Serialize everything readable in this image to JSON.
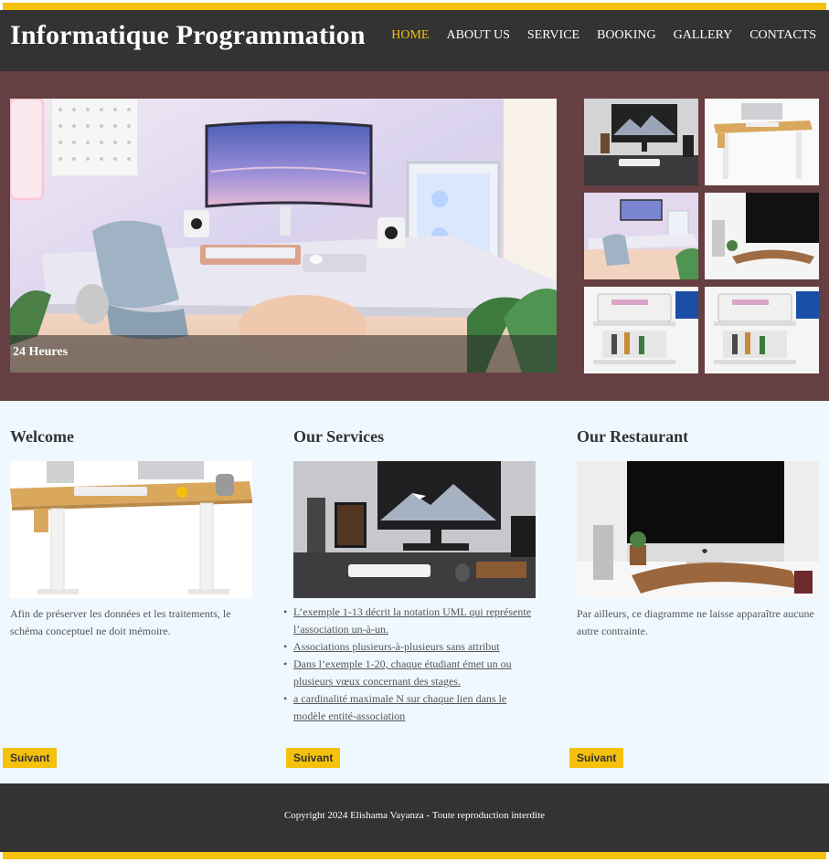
{
  "header": {
    "title": "Informatique Programmation",
    "nav": [
      {
        "label": "HOME",
        "active": true
      },
      {
        "label": "ABOUT US"
      },
      {
        "label": "SERVICE"
      },
      {
        "label": "BOOKING"
      },
      {
        "label": "GALLERY"
      },
      {
        "label": "CONTACTS"
      }
    ]
  },
  "hero": {
    "caption": "24 Heures"
  },
  "sections": {
    "welcome": {
      "title": "Welcome",
      "text": "Afin de préserver les données et les traitements, le schéma conceptuel ne doit mémoire.",
      "button": "Suivant"
    },
    "services": {
      "title": "Our Services",
      "items": [
        "L’exemple 1-13 décrit la notation UML qui représente l’association un-à-un.",
        "Associations plusieurs-à-plusieurs sans attribut",
        "Dans l’exemple 1-20, chaque étudiant émet un ou plusieurs vœux concernant des stages.",
        "a cardinalité maximale N sur chaque lien dans le modèle entité-association"
      ],
      "button": "Suivant"
    },
    "restaurant": {
      "title": "Our Restaurant",
      "text": "Par ailleurs, ce diagramme ne laisse apparaître aucune autre contrainte.",
      "button": "Suivant"
    }
  },
  "footer": {
    "copyright": "Copyright 2024 Elishama Vayanza - Toute reproduction interdite"
  },
  "colors": {
    "accent": "#f4c20d",
    "header_bg": "#333333",
    "hero_bg": "#663f42",
    "content_bg": "#f0f8ff"
  }
}
